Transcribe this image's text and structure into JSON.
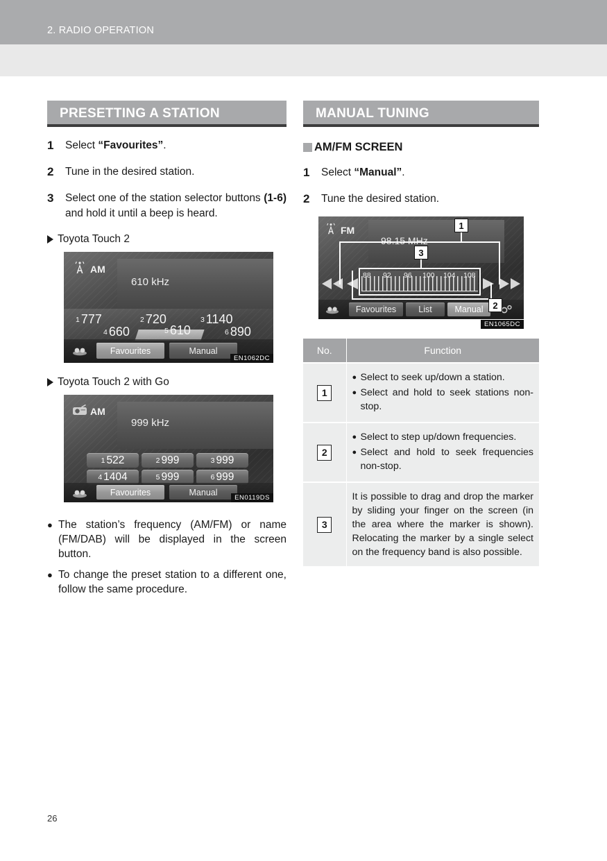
{
  "header": {
    "chapter_title": "2. RADIO OPERATION"
  },
  "page_number": "26",
  "left_column": {
    "section_title": "PRESETTING A STATION",
    "steps": [
      {
        "num": "1",
        "text_before": "Select ",
        "bold": "“Favourites”",
        "text_after": "."
      },
      {
        "num": "2",
        "text_before": "Tune in the desired station.",
        "bold": "",
        "text_after": ""
      },
      {
        "num": "3",
        "text_before": "Select one of the station selector buttons ",
        "bold": "(1-6)",
        "text_after": " and hold it until a beep is heard."
      }
    ],
    "variant1_label": "Toyota Touch 2",
    "variant2_label": "Toyota Touch 2 with Go",
    "screen1": {
      "band": "AM",
      "frequency": "610 kHz",
      "presets": [
        {
          "no": "1",
          "value": "777"
        },
        {
          "no": "2",
          "value": "720"
        },
        {
          "no": "3",
          "value": "1140"
        },
        {
          "no": "4",
          "value": "660"
        },
        {
          "no": "5",
          "value": "610"
        },
        {
          "no": "6",
          "value": "890"
        }
      ],
      "tabs": [
        "Favourites",
        "Manual"
      ],
      "active_tab": "Favourites",
      "code": "EN1062DC"
    },
    "screen2": {
      "band": "AM",
      "frequency": "999 kHz",
      "presets": [
        {
          "no": "1",
          "value": "522"
        },
        {
          "no": "2",
          "value": "999"
        },
        {
          "no": "3",
          "value": "999"
        },
        {
          "no": "4",
          "value": "1404"
        },
        {
          "no": "5",
          "value": "999"
        },
        {
          "no": "6",
          "value": "999"
        }
      ],
      "tabs": [
        "Favourites",
        "Manual"
      ],
      "active_tab": "Favourites",
      "code": "EN0119DS"
    },
    "notes": [
      "The station’s frequency (AM/FM) or name (FM/DAB) will be displayed in the screen button.",
      "To change the preset station to a different one, follow the same procedure."
    ]
  },
  "right_column": {
    "section_title": "MANUAL TUNING",
    "sub_heading": "AM/FM SCREEN",
    "steps": [
      {
        "num": "1",
        "text_before": "Select ",
        "bold": "“Manual”",
        "text_after": "."
      },
      {
        "num": "2",
        "text_before": "Tune the desired station.",
        "bold": "",
        "text_after": ""
      }
    ],
    "screen": {
      "band": "FM",
      "frequency": "98.15 MHz",
      "scale_labels": [
        "88",
        "92",
        "96",
        "100",
        "104",
        "108"
      ],
      "tabs": [
        "Favourites",
        "List",
        "Manual"
      ],
      "active_tab": "Manual",
      "callouts": [
        "1",
        "2",
        "3"
      ],
      "code": "EN1065DC"
    },
    "table": {
      "headers": [
        "No.",
        "Function"
      ],
      "rows": [
        {
          "no": "1",
          "bullets": [
            "Select to seek up/down a station.",
            "Select and hold to seek stations non-stop."
          ],
          "paragraph": ""
        },
        {
          "no": "2",
          "bullets": [
            "Select to step up/down frequencies.",
            "Select and hold to seek frequencies non-stop."
          ],
          "paragraph": ""
        },
        {
          "no": "3",
          "bullets": [],
          "paragraph": "It is possible to drag and drop the marker by sliding your finger on the screen (in the area where the marker is shown). Relocating the marker by a single select on the frequency band is also possible."
        }
      ]
    }
  },
  "colors": {
    "header_band": "#aaabad",
    "header_band2": "#e9e9e9",
    "section_bar": "#a8a9ab",
    "table_header": "#a3a4a6",
    "table_cell": "#eceded"
  }
}
